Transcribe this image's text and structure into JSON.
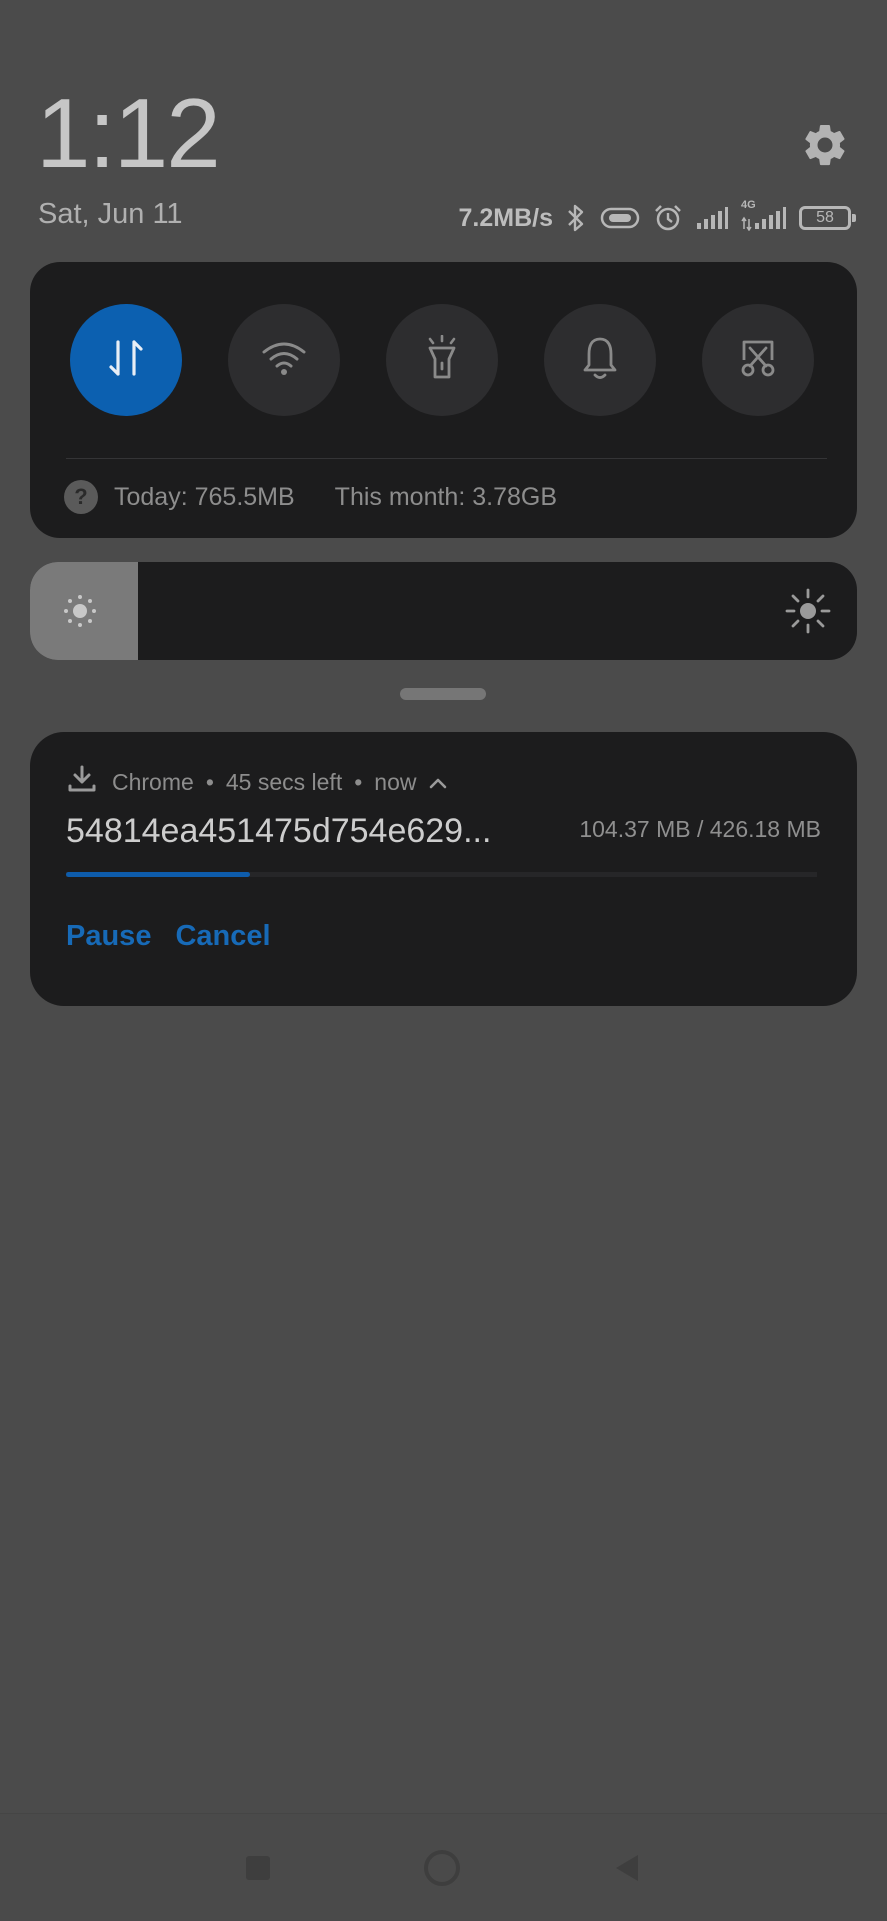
{
  "header": {
    "time": "1:12",
    "date": "Sat, Jun 11"
  },
  "status_bar": {
    "net_speed": "7.2MB/s",
    "network_type": "4G",
    "battery": "58",
    "icons": [
      "bluetooth-icon",
      "vibrate-icon",
      "alarm-icon",
      "signal-icon",
      "signal-4g-icon",
      "battery-icon"
    ]
  },
  "quick_settings": {
    "tiles": [
      {
        "name": "mobile-data",
        "icon": "data-transfer-icon",
        "active": true
      },
      {
        "name": "wifi",
        "icon": "wifi-icon",
        "active": false
      },
      {
        "name": "flashlight",
        "icon": "flashlight-icon",
        "active": false
      },
      {
        "name": "sound",
        "icon": "bell-icon",
        "active": false
      },
      {
        "name": "screenshot",
        "icon": "scissors-icon",
        "active": false
      }
    ],
    "usage": {
      "today": "Today: 765.5MB",
      "month": "This month: 3.78GB"
    }
  },
  "brightness": {
    "level_fraction": 0.13
  },
  "notification": {
    "app": "Chrome",
    "sep1": "•",
    "time_left": "45 secs left",
    "sep2": "•",
    "when": "now",
    "title": "54814ea451475d754e629...",
    "size": "104.37 MB / 426.18 MB",
    "progress_fraction": 0.245,
    "actions": {
      "pause": "Pause",
      "cancel": "Cancel"
    }
  },
  "colors": {
    "accent": "#0c60b0",
    "link": "#176ab7",
    "card": "#1c1c1d",
    "backdrop": "#4b4b4b"
  }
}
